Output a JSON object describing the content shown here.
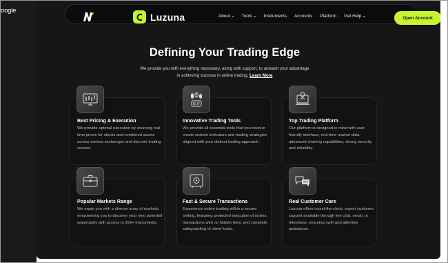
{
  "browser": {
    "partial_text": "oogle"
  },
  "header": {
    "brand": "Luzuna",
    "menu": [
      {
        "label": "About",
        "dropdown": true
      },
      {
        "label": "Tools",
        "dropdown": true
      },
      {
        "label": "Instruments",
        "dropdown": false
      },
      {
        "label": "Accounts",
        "dropdown": false
      },
      {
        "label": "Platform",
        "dropdown": false
      },
      {
        "label": "Get Help",
        "dropdown": true
      }
    ],
    "cta": "Open Account"
  },
  "hero": {
    "title": "Defining Your Trading Edge",
    "subtitle": "We provide you with everything necessary, along with support, to unleash your advantage in achieving success in online trading.",
    "link": "Learn More"
  },
  "features": [
    {
      "icon": "monitor-chart-icon",
      "title": "Best Pricing & Execution",
      "text": "We provide optimal execution by sourcing real-time prices for stocks and combined assets across various exchanges and discreet trading venues."
    },
    {
      "icon": "buy-candles-icon",
      "title": "Innovative Trading Tools",
      "text": "We provide all essential tools that you need to create custom indicators and trading strategies aligned with your distinct trading approach."
    },
    {
      "icon": "laptop-platform-icon",
      "title": "Top Trading Platform",
      "text": "Our platform is designed in mind with user-friendly interface, real-time market data, advanced charting capabilities, strong security and reliability."
    },
    {
      "icon": "briefcase-icon",
      "title": "Popular Markets Range",
      "text": "We equip you with a diverse array of markets, empowering you to discover your next potential opportunity with access to 250+ instruments."
    },
    {
      "icon": "safe-icon",
      "title": "Fast & Secure Transactions",
      "text": "Experience online trading within a secure setting, featuring protected execution of orders, transactions with no hidden fees, and complete safeguarding of client funds."
    },
    {
      "icon": "support-chat-icon",
      "title": "Real Customer Care",
      "text": "Luzuna offers round-the-clock, expert customer support available through live chat, email, or telephone, ensuring swift and attentive assistance."
    }
  ],
  "colors": {
    "accent": "#c6f432",
    "background": "#161616",
    "card": "#121212"
  }
}
